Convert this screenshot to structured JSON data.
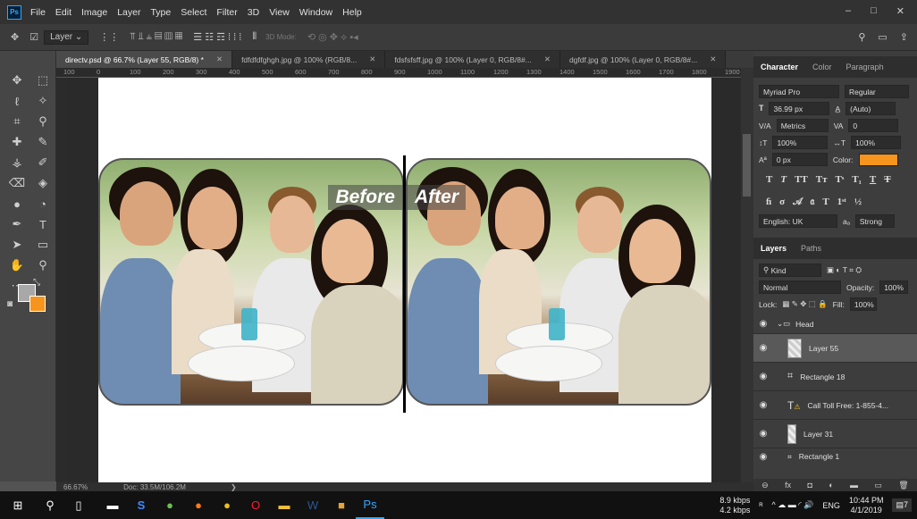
{
  "menubar": {
    "logo": "Ps",
    "items": [
      "File",
      "Edit",
      "Image",
      "Layer",
      "Type",
      "Select",
      "Filter",
      "3D",
      "View",
      "Window",
      "Help"
    ],
    "win_controls": [
      "–",
      "□",
      "✕"
    ]
  },
  "options": {
    "layer_select": "Layer",
    "mode3d": "3D Mode:"
  },
  "tabs": [
    {
      "label": "directv.psd @ 66.7% (Layer 55, RGB/8) *",
      "active": true
    },
    {
      "label": "fdfdfdfghgh.jpg @ 100% (RGB/8...",
      "active": false
    },
    {
      "label": "fdsfsfsff.jpg @ 100% (Layer 0, RGB/8#...",
      "active": false
    },
    {
      "label": "dgfdf.jpg @ 100% (Layer 0, RGB/8#...",
      "active": false
    }
  ],
  "ruler": {
    "marks": [
      "100",
      "0",
      "100",
      "200",
      "300",
      "400",
      "500",
      "600",
      "700",
      "800",
      "900",
      "1000",
      "1100",
      "1200",
      "1300",
      "1400",
      "1500",
      "1600",
      "1700",
      "1800",
      "1900"
    ]
  },
  "canvas": {
    "before_label": "Before",
    "after_label": "After"
  },
  "status": {
    "zoom": "66.67%",
    "doc": "Doc: 33.5M/106.2M"
  },
  "character": {
    "tabs": [
      "Character",
      "Color",
      "Paragraph"
    ],
    "font": "Myriad Pro",
    "style": "Regular",
    "size": "36.99 px",
    "leading": "(Auto)",
    "kerning": "Metrics",
    "tracking": "0",
    "vscale": "100%",
    "hscale": "100%",
    "baseline": "0 px",
    "color_label": "Color:",
    "color": "#f7941d",
    "language": "English: UK",
    "aa_label": "aₐ",
    "aa": "Strong"
  },
  "layers": {
    "tabs": [
      "Layers",
      "Paths"
    ],
    "filter": "Kind",
    "blend": "Normal",
    "opacity_label": "Opacity:",
    "opacity": "100%",
    "lock_label": "Lock:",
    "fill_label": "Fill:",
    "fill": "100%",
    "items": [
      {
        "name": "Head",
        "kind": "group",
        "selected": false
      },
      {
        "name": "Layer 55",
        "kind": "pixel",
        "selected": true
      },
      {
        "name": "Rectangle 18",
        "kind": "shape",
        "selected": false
      },
      {
        "name": "Call Toll Free: 1-855-4...",
        "kind": "text",
        "selected": false
      },
      {
        "name": "Layer 31",
        "kind": "pixel",
        "selected": false
      },
      {
        "name": "Rectangle 1",
        "kind": "shape",
        "selected": false
      }
    ]
  },
  "taskbar": {
    "net_down": "8.9 kbps",
    "net_up": "4.2 kbps",
    "lang": "ENG",
    "time": "10:44 PM",
    "date": "4/1/2019",
    "notif_count": "7"
  }
}
